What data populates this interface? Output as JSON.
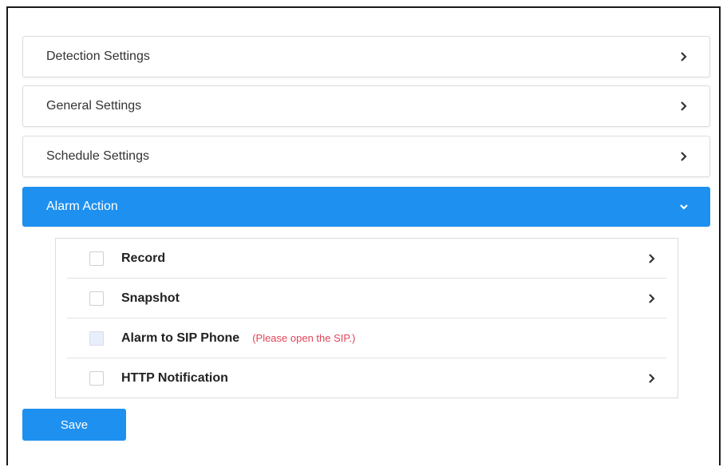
{
  "panels": [
    {
      "label": "Detection Settings",
      "icon": "chevron-right-icon"
    },
    {
      "label": "General Settings",
      "icon": "chevron-right-icon"
    },
    {
      "label": "Schedule Settings",
      "icon": "chevron-right-icon"
    },
    {
      "label": "Alarm Action",
      "icon": "chevron-down-icon",
      "expanded": true
    }
  ],
  "alarm_action": {
    "items": [
      {
        "label": "Record",
        "checked": false,
        "has_chevron": true
      },
      {
        "label": "Snapshot",
        "checked": false,
        "has_chevron": true
      },
      {
        "label": "Alarm to SIP Phone",
        "checked": false,
        "disabled": true,
        "note": "(Please open the SIP.)"
      },
      {
        "label": "HTTP Notification",
        "checked": false,
        "has_chevron": true
      }
    ]
  },
  "save_label": "Save",
  "colors": {
    "accent": "#1e90f0",
    "note": "#e0445a",
    "text": "#333333"
  }
}
